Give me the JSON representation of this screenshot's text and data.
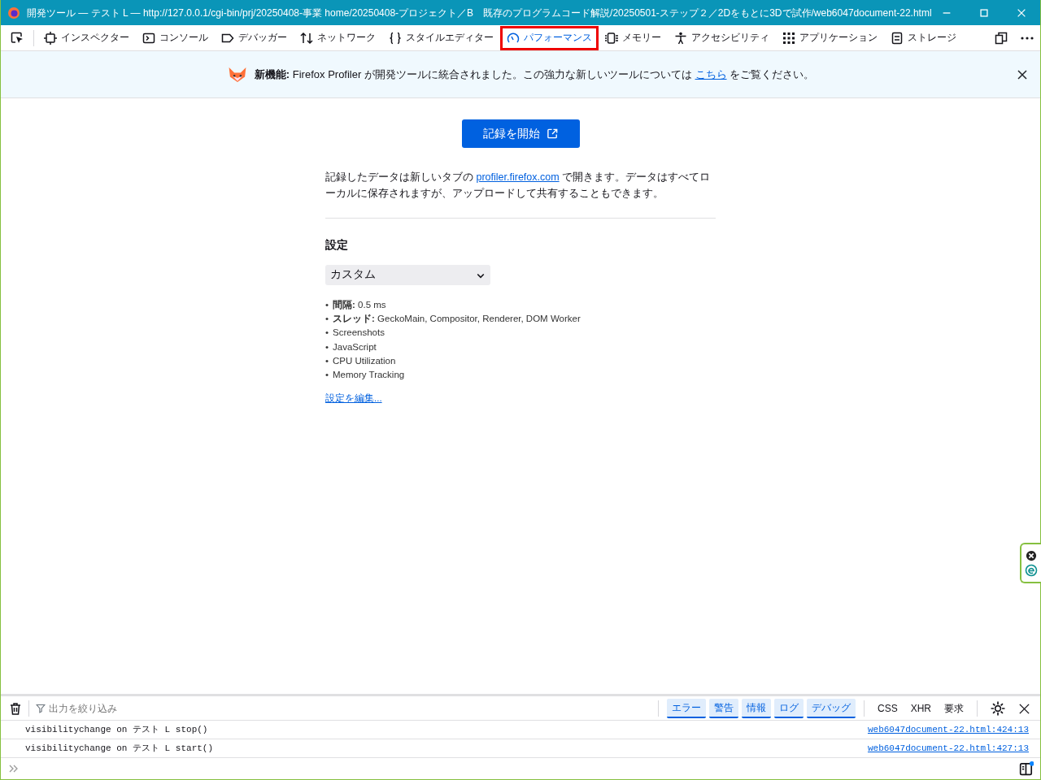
{
  "window": {
    "title": "開発ツール — テスト L — http://127.0.0.1/cgi-bin/prj/20250408-事業 home/20250408-プロジェクト／B　既存のプログラムコード解説/20250501-ステップ２／2Dをもとに3Dで試作/web6047document-22.html"
  },
  "tabs": [
    {
      "label": "インスペクター",
      "selected": false,
      "highlighted": false
    },
    {
      "label": "コンソール",
      "selected": false,
      "highlighted": false
    },
    {
      "label": "デバッガー",
      "selected": false,
      "highlighted": false
    },
    {
      "label": "ネットワーク",
      "selected": false,
      "highlighted": false
    },
    {
      "label": "スタイルエディター",
      "selected": false,
      "highlighted": false
    },
    {
      "label": "パフォーマンス",
      "selected": true,
      "highlighted": true
    },
    {
      "label": "メモリー",
      "selected": false,
      "highlighted": false
    },
    {
      "label": "アクセシビリティ",
      "selected": false,
      "highlighted": false
    },
    {
      "label": "アプリケーション",
      "selected": false,
      "highlighted": false
    },
    {
      "label": "ストレージ",
      "selected": false,
      "highlighted": false
    }
  ],
  "notice": {
    "before": "**新機能:** Firefox Profiler が開発ツールに統合されました。この強力な新しいツールについては",
    "link": "こちら",
    "after": "をご覧ください。"
  },
  "record_button": "記録を開始",
  "description": {
    "before": "記録したデータは新しいタブの",
    "link": "profiler.firefox.com",
    "after": "で開きます。データはすべてローカルに保存されますが、アップロードして共有することもできます。"
  },
  "settings": {
    "heading": "設定",
    "preset": "カスタム",
    "marker": "•",
    "items": [
      "**間隔:** 0.5 ms",
      "**スレッド:** GeckoMain, Compositor, Renderer, DOM Worker",
      "Screenshots",
      "JavaScript",
      "CPU Utilization",
      "Memory Tracking"
    ],
    "edit_link": "設定を編集..."
  },
  "console": {
    "filter_placeholder": "出力を絞り込み",
    "levels": [
      {
        "label": "エラー",
        "selected": true
      },
      {
        "label": "警告",
        "selected": true
      },
      {
        "label": "情報",
        "selected": true
      },
      {
        "label": "ログ",
        "selected": true
      },
      {
        "label": "デバッグ",
        "selected": true
      }
    ],
    "types": [
      {
        "label": "CSS",
        "selected": false
      },
      {
        "label": "XHR",
        "selected": false
      },
      {
        "label": "要求",
        "selected": false
      }
    ],
    "messages": [
      {
        "text": "visibilitychange on テスト L stop()",
        "source": "web6047document-22.html:424:13"
      },
      {
        "text": "visibilitychange on テスト L start()",
        "source": "web6047document-22.html:427:13"
      }
    ]
  }
}
